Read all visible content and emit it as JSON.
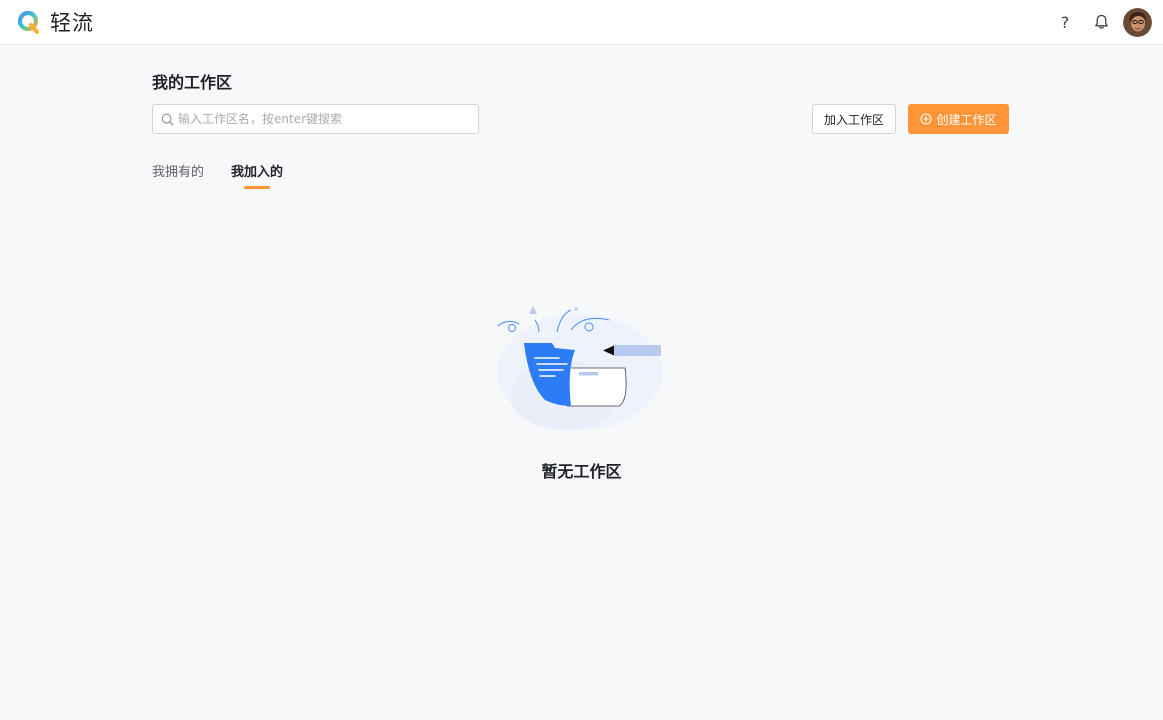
{
  "app": {
    "name": "轻流",
    "accent_color": "#ff9537",
    "logo_icon": "q-logo-icon"
  },
  "header": {
    "help_icon": "question-icon",
    "help_glyph": "?",
    "notification_icon": "bell-icon",
    "avatar_icon": "user-avatar"
  },
  "main": {
    "title": "我的工作区",
    "search": {
      "placeholder": "输入工作区名，按enter键搜索",
      "value": ""
    },
    "join_button_label": "加入工作区",
    "create_button_label": "创建工作区",
    "tabs": [
      {
        "label": "我拥有的",
        "active": false
      },
      {
        "label": "我加入的",
        "active": true
      }
    ],
    "empty_state": {
      "message": "暂无工作区"
    }
  }
}
